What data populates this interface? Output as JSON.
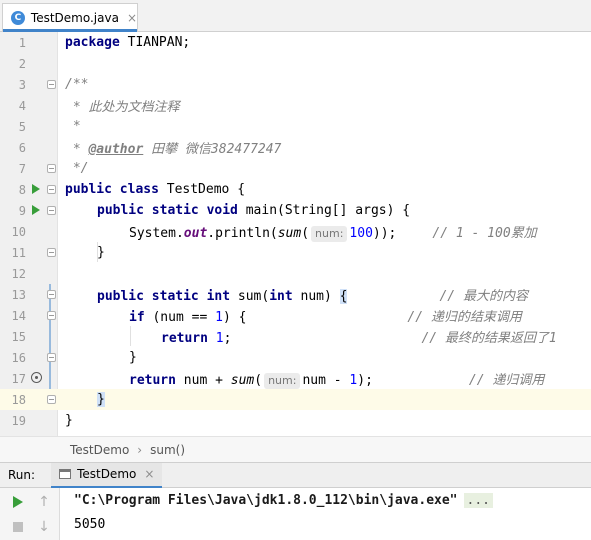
{
  "tab": {
    "icon_letter": "C",
    "filename": "TestDemo.java",
    "close": "×"
  },
  "editor": {
    "lines": {
      "n1": "1",
      "n2": "2",
      "n3": "3",
      "n4": "4",
      "n5": "5",
      "n6": "6",
      "n7": "7",
      "n8": "8",
      "n9": "9",
      "n10": "10",
      "n11": "11",
      "n12": "12",
      "n13": "13",
      "n14": "14",
      "n15": "15",
      "n16": "16",
      "n17": "17",
      "n18": "18",
      "n19": "19"
    },
    "code": {
      "l1_kw": "package",
      "l1_rest": " TIANPAN;",
      "l3": "/**",
      "l4": " * 此处为文档注释",
      "l5": " *",
      "l6_star": " * ",
      "l6_tag": "@author",
      "l6_rest": " 田攀 微信382477247",
      "l7": " */",
      "l8_kw": "public class",
      "l8_rest": " TestDemo {",
      "l9_kw": "public static void",
      "l9_rest": " main(String[] args) {",
      "l10_a": "System.",
      "l10_out": "out",
      "l10_b": ".println(",
      "l10_sum": "sum",
      "l10_c": "(",
      "l10_hint": "num:",
      "l10_num": "100",
      "l10_d": "));",
      "l10_cmt": "// 1 - 100累加",
      "l11": "}",
      "l13_kw": "public static int",
      "l13_a": " sum(",
      "l13_kw2": "int",
      "l13_b": " num) ",
      "l13_brace": "{",
      "l13_cmt": "// 最大的内容",
      "l14_kw": "if",
      "l14_a": " (num == ",
      "l14_num": "1",
      "l14_b": ") {",
      "l14_cmt": "// 递归的结束调用",
      "l15_kw": "return",
      "l15_num": "1",
      "l15_b": ";",
      "l15_cmt": "// 最终的结果返回了1",
      "l16": "}",
      "l17_kw": "return",
      "l17_a": " num + ",
      "l17_sum": "sum",
      "l17_b": "(",
      "l17_hint": "num:",
      "l17_c": "num - ",
      "l17_num": "1",
      "l17_d": ");",
      "l17_cmt": "// 递归调用",
      "l18": "}",
      "l19": "}"
    }
  },
  "breadcrumb": {
    "class": "TestDemo",
    "sep": "›",
    "method": "sum()"
  },
  "run": {
    "label": "Run:",
    "tab_label": "TestDemo",
    "tab_close": "×",
    "command": "\"C:\\Program Files\\Java\\jdk1.8.0_112\\bin\\java.exe\"",
    "ellipsis": "...",
    "output": "5050",
    "up_arrow": "↑",
    "down_arrow": "↓"
  },
  "colors": {
    "accent": "#4083c9",
    "keyword": "#000080",
    "number": "#0000ff",
    "comment": "#808080",
    "run_green": "#389e3a",
    "current_line": "#fefbe8"
  }
}
